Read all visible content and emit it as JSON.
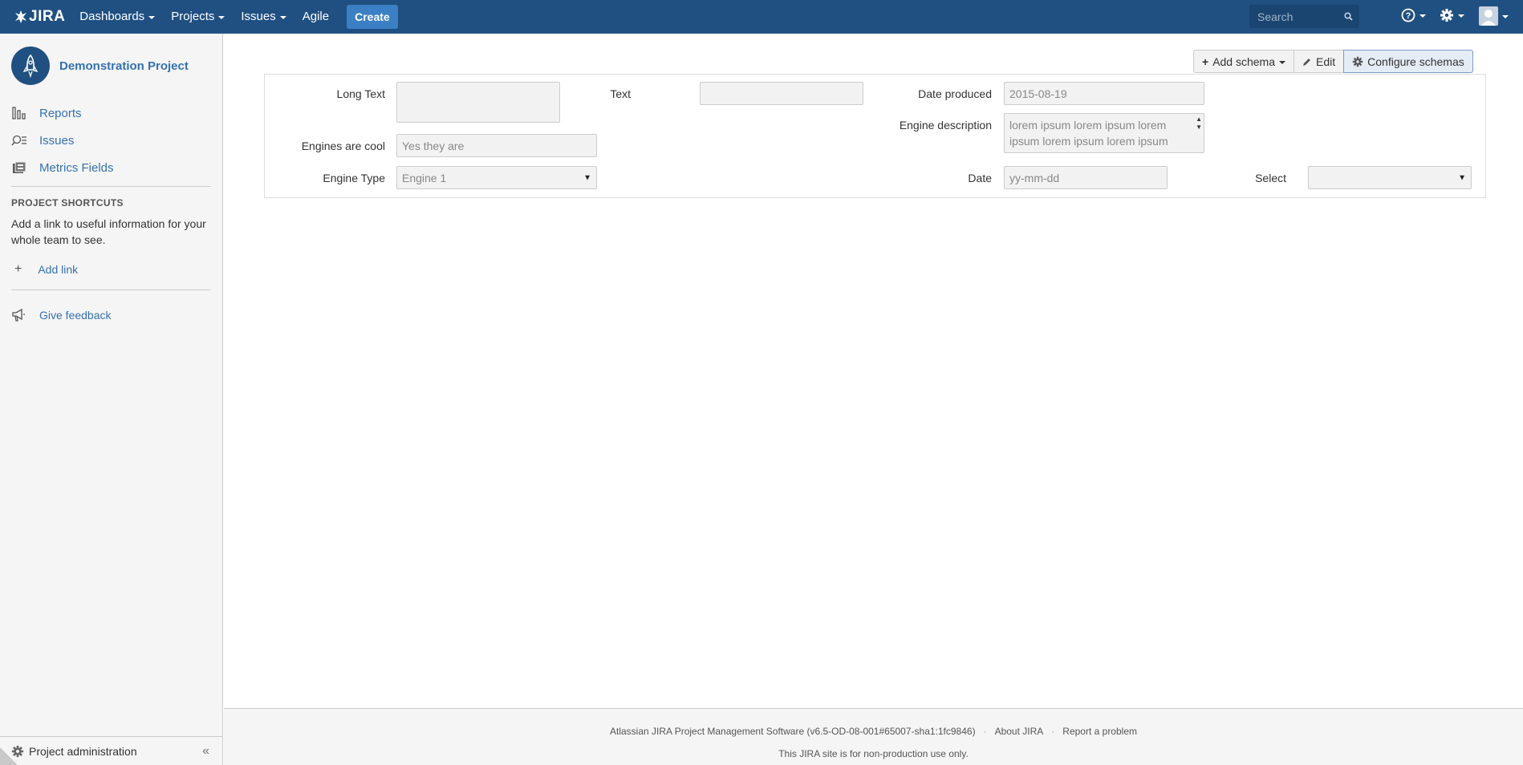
{
  "header": {
    "logo_text": "JIRA",
    "nav": [
      {
        "label": "Dashboards",
        "dropdown": true
      },
      {
        "label": "Projects",
        "dropdown": true
      },
      {
        "label": "Issues",
        "dropdown": true
      },
      {
        "label": "Agile",
        "dropdown": false
      }
    ],
    "create_label": "Create",
    "search_placeholder": "Search",
    "icons": [
      "help-icon",
      "gear-icon",
      "user-avatar-icon"
    ]
  },
  "sidebar": {
    "project_name": "Demonstration Project",
    "items": [
      {
        "label": "Reports",
        "icon": "reports-icon"
      },
      {
        "label": "Issues",
        "icon": "issues-icon"
      },
      {
        "label": "Metrics Fields",
        "icon": "metrics-icon"
      }
    ],
    "shortcuts_title": "PROJECT SHORTCUTS",
    "shortcuts_desc": "Add a link to useful information for your whole team to see.",
    "add_link": "Add link",
    "feedback": "Give feedback",
    "admin": "Project administration",
    "collapse": "«"
  },
  "toolbar": {
    "add_schema": "Add schema",
    "edit": "Edit",
    "configure": "Configure schemas"
  },
  "form": {
    "long_text_label": "Long Text",
    "text_label": "Text",
    "date_produced_label": "Date produced",
    "date_produced_value": "2015-08-19",
    "engine_description_label": "Engine description",
    "engine_description_value": "lorem ipsum lorem ipsum lorem ipsum lorem ipsum lorem ipsum",
    "engines_cool_label": "Engines are cool",
    "engines_cool_value": "Yes they are",
    "engine_type_label": "Engine Type",
    "engine_type_value": "Engine 1",
    "date_label": "Date",
    "date_placeholder": "yy-mm-dd",
    "select_label": "Select",
    "select_value": ""
  },
  "footer": {
    "version": "Atlassian JIRA Project Management Software (v6.5-OD-08-001#65007-sha1:1fc9846)",
    "about": "About JIRA",
    "report": "Report a problem",
    "notice": "This JIRA site is for non-production use only."
  }
}
